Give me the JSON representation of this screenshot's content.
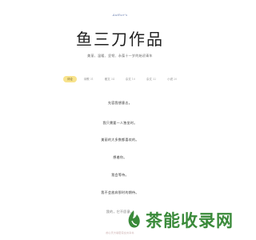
{
  "header": {
    "brand": "Author's",
    "title": "鱼三刀作品",
    "subtitle": "美丽、温暖、坚韧、永葆十一岁的始初青年"
  },
  "tabs": [
    {
      "label": "评论",
      "count": "",
      "active": true
    },
    {
      "label": "诗歌",
      "count": "31",
      "active": false
    },
    {
      "label": "散文",
      "count": "34",
      "active": false
    },
    {
      "label": "杂文",
      "count": "10",
      "active": false
    },
    {
      "label": "杂文",
      "count": "32",
      "active": false
    },
    {
      "label": "小说",
      "count": "20",
      "active": false
    }
  ],
  "poem": {
    "lines": [
      "先容我想意志。",
      "我只需要一人独坐时。",
      "美丽的大多数都喜欢的。",
      "想着你。",
      "我会等待。",
      "我不会放弃那时的期待。",
      "我的，它不愿意。"
    ]
  },
  "footer": {
    "text": "的心灵大秘密完全共享书"
  },
  "watermark": {
    "text": "茶能收录网",
    "color": "#3a8a3a"
  },
  "colors": {
    "tab_active_bg": "#f8e38c",
    "brand": "#6a7fb0"
  }
}
